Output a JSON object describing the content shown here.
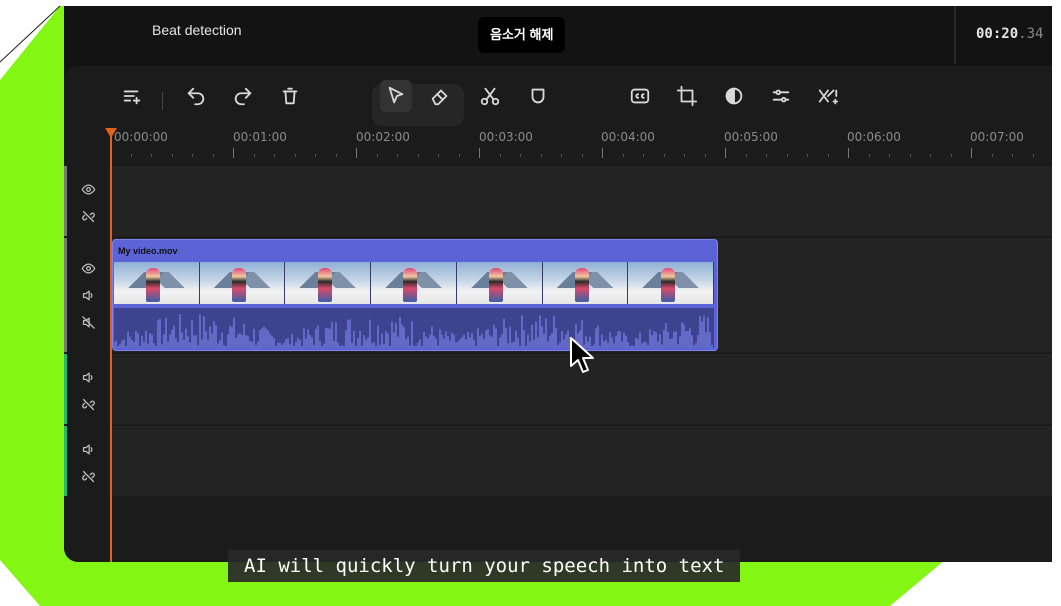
{
  "header": {
    "beat_detection_label": "Beat detection",
    "tooltip": "음소거 해제",
    "timecode_main": "00:20",
    "timecode_dim": ".34"
  },
  "toolbar": {
    "icons": [
      "add-track-icon",
      "undo-icon",
      "redo-icon",
      "delete-icon",
      "select-pointer-icon",
      "eraser-icon",
      "scissors-icon",
      "shield-icon",
      "captions-icon",
      "crop-icon",
      "color-icon",
      "adjust-icon",
      "transition-icon"
    ]
  },
  "ruler": {
    "labels": [
      "00:00:00",
      "00:01:00",
      "00:02:00",
      "00:03:00",
      "00:04:00",
      "00:05:00",
      "00:06:00",
      "00:07:00"
    ]
  },
  "tracks": [
    {
      "type": "video",
      "accent": "#7a7a7a"
    },
    {
      "type": "video-main",
      "accent": "#7a7a7a"
    },
    {
      "type": "audio",
      "accent": "#2bb673"
    },
    {
      "type": "audio",
      "accent": "#2bb673"
    }
  ],
  "clip": {
    "name": "My video.mov"
  },
  "caption": {
    "text": "AI will quickly turn your speech into text"
  },
  "colors": {
    "brand_green": "#84f614",
    "clip_blue": "#5b63d6",
    "playhead": "#e0631c"
  }
}
